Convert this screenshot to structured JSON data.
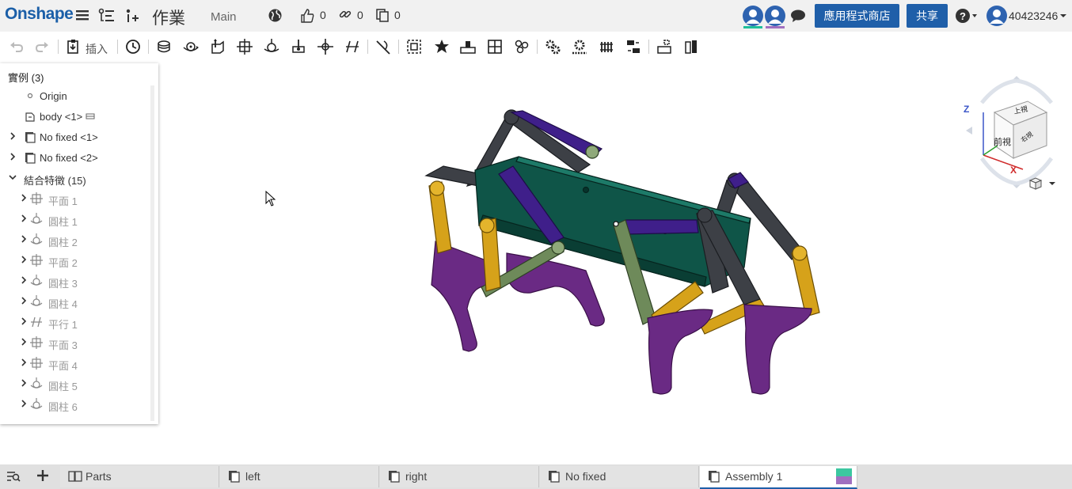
{
  "header": {
    "logo": "Onshape",
    "document_title": "作業",
    "branch": "Main",
    "likes": "0",
    "links": "0",
    "copies": "0",
    "app_store_label": "應用程式商店",
    "share_label": "共享",
    "user_name": "40423246",
    "collaborator_colors": [
      "#1fbf9a",
      "#a06fc0"
    ]
  },
  "toolbar": {
    "insert_label": "插入",
    "tools": [
      "undo-icon",
      "redo-icon",
      "insert-icon",
      "history-icon",
      "fastened-mate-icon",
      "revolute-mate-icon",
      "slider-mate-icon",
      "planar-mate-icon",
      "cylindrical-mate-icon",
      "pin-slot-mate-icon",
      "ball-mate-icon",
      "parallel-mate-icon",
      "tangent-mate-icon",
      "group-icon",
      "mate-connector-icon",
      "replicate-icon",
      "linear-pattern-icon",
      "circular-pattern-icon",
      "gear-relation-icon",
      "rack-pinion-icon",
      "screw-relation-icon",
      "linear-relation-icon",
      "explode-icon",
      "section-icon"
    ]
  },
  "instances_panel": {
    "title": "實例 (3)",
    "rows": [
      {
        "label": "Origin",
        "icon": "origin-icon",
        "expandable": false,
        "dim": false,
        "indent": 1
      },
      {
        "label": "body <1>",
        "icon": "part-icon",
        "expandable": false,
        "dim": false,
        "indent": 1
      },
      {
        "label": "No fixed <1>",
        "icon": "assembly-icon",
        "expandable": true,
        "dim": false,
        "indent": 1
      },
      {
        "label": "No fixed <2>",
        "icon": "assembly-icon",
        "expandable": true,
        "dim": false,
        "indent": 1
      },
      {
        "label": "結合特徵 (15)",
        "icon": "",
        "expandable": true,
        "dim": false,
        "indent": 0
      },
      {
        "label": "平面 1",
        "icon": "planar-mate-icon",
        "expandable": true,
        "dim": true,
        "indent": 2
      },
      {
        "label": "圓柱 1",
        "icon": "cylindrical-mate-icon",
        "expandable": true,
        "dim": true,
        "indent": 2
      },
      {
        "label": "圓柱 2",
        "icon": "cylindrical-mate-icon",
        "expandable": true,
        "dim": true,
        "indent": 2
      },
      {
        "label": "平面 2",
        "icon": "planar-mate-icon",
        "expandable": true,
        "dim": true,
        "indent": 2
      },
      {
        "label": "圓柱 3",
        "icon": "cylindrical-mate-icon",
        "expandable": true,
        "dim": true,
        "indent": 2
      },
      {
        "label": "圓柱 4",
        "icon": "cylindrical-mate-icon",
        "expandable": true,
        "dim": true,
        "indent": 2
      },
      {
        "label": "平行 1",
        "icon": "parallel-mate-icon",
        "expandable": true,
        "dim": true,
        "indent": 2
      },
      {
        "label": "平面 3",
        "icon": "planar-mate-icon",
        "expandable": true,
        "dim": true,
        "indent": 2
      },
      {
        "label": "平面 4",
        "icon": "planar-mate-icon",
        "expandable": true,
        "dim": true,
        "indent": 2
      },
      {
        "label": "圓柱 5",
        "icon": "cylindrical-mate-icon",
        "expandable": true,
        "dim": true,
        "indent": 2
      },
      {
        "label": "圓柱 6",
        "icon": "cylindrical-mate-icon",
        "expandable": true,
        "dim": true,
        "indent": 2
      }
    ]
  },
  "view_cube": {
    "top": "上視",
    "front": "前視",
    "right": "右視",
    "axis_z": "Z",
    "axis_x": "X"
  },
  "model_colors": {
    "body": "#0f5548",
    "dark_link": "#3d4046",
    "purple_link": "#3f1f8a",
    "yellow_link": "#d6a21a",
    "green_link": "#6e8a5a",
    "leg": "#6a2a84"
  },
  "tabs": [
    {
      "label": "Parts",
      "icon": "parts-studio-icon",
      "active": false
    },
    {
      "label": "left",
      "icon": "assembly-icon",
      "active": false
    },
    {
      "label": "right",
      "icon": "assembly-icon",
      "active": false
    },
    {
      "label": "No fixed",
      "icon": "assembly-icon",
      "active": false
    },
    {
      "label": "Assembly 1",
      "icon": "assembly-icon",
      "active": true
    }
  ]
}
